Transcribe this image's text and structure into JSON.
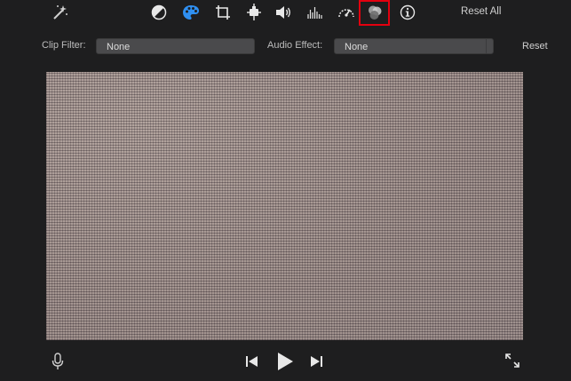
{
  "toolbar": {
    "reset_all_label": "Reset All",
    "icons": [
      "magic-wand-icon",
      "color-balance-icon",
      "color-correction-icon",
      "crop-icon",
      "stabilization-icon",
      "volume-icon",
      "noise-reduction-icon",
      "speed-icon",
      "clip-filter-icon",
      "info-icon"
    ],
    "active_icon": "color-correction-icon",
    "highlighted_icon": "clip-filter-icon",
    "accent_color": "#2f8ff0",
    "highlight_color": "#e3000f"
  },
  "filters": {
    "clip_filter_label": "Clip Filter:",
    "clip_filter_value": "None",
    "audio_effect_label": "Audio Effect:",
    "audio_effect_value": "None",
    "reset_label": "Reset"
  },
  "controls": {
    "icons": [
      "microphone-icon",
      "skip-back-icon",
      "play-icon",
      "skip-forward-icon",
      "fullscreen-icon"
    ]
  }
}
